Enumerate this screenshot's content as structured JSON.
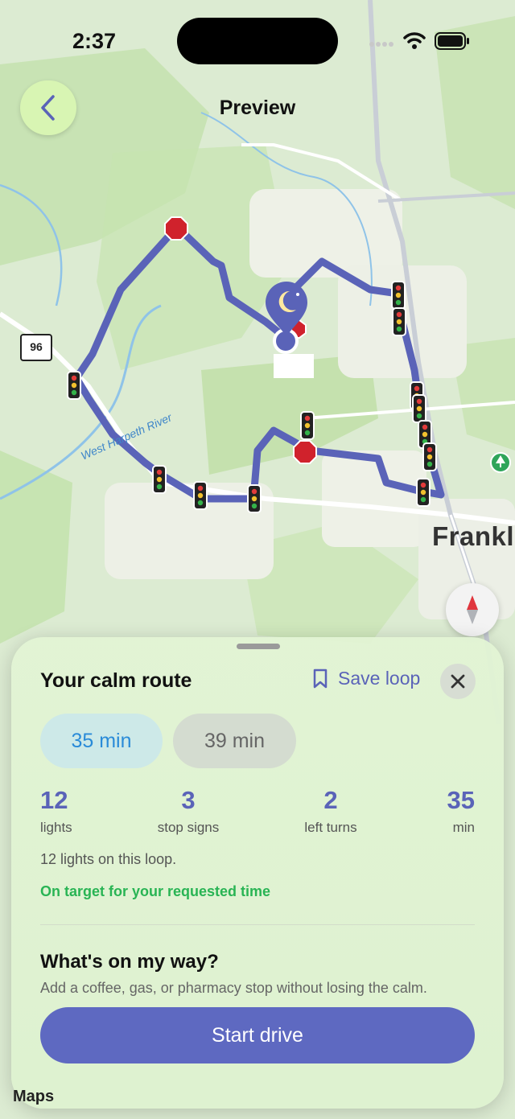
{
  "status_bar": {
    "time": "2:37"
  },
  "header": {
    "title": "Preview"
  },
  "map": {
    "highway_shield": "96",
    "city_label": "Frankli",
    "river_label": "West Harpeth River",
    "maps_logo": "Maps",
    "route_color": "#5a63b8"
  },
  "sheet": {
    "title": "Your calm route",
    "save_label": "Save loop",
    "options": [
      {
        "label": "35 min",
        "selected": true
      },
      {
        "label": "39 min",
        "selected": false
      }
    ],
    "stats": [
      {
        "value": "12",
        "label": "lights"
      },
      {
        "value": "3",
        "label": "stop signs"
      },
      {
        "value": "2",
        "label": "left turns"
      },
      {
        "value": "35",
        "label": "min"
      }
    ],
    "note": "12 lights on this loop.",
    "target_text": "On target for your requested time",
    "target_color": "#29b454",
    "way_title": "What's on my way?",
    "way_subtitle": "Add a coffee, gas, or pharmacy stop without losing the calm.",
    "start_label": "Start drive"
  },
  "icons": [
    "back-chevron-icon",
    "bookmark-icon",
    "close-icon",
    "compass-icon",
    "moon-pin-icon",
    "traffic-light-icon",
    "stop-sign-icon",
    "park-icon"
  ]
}
